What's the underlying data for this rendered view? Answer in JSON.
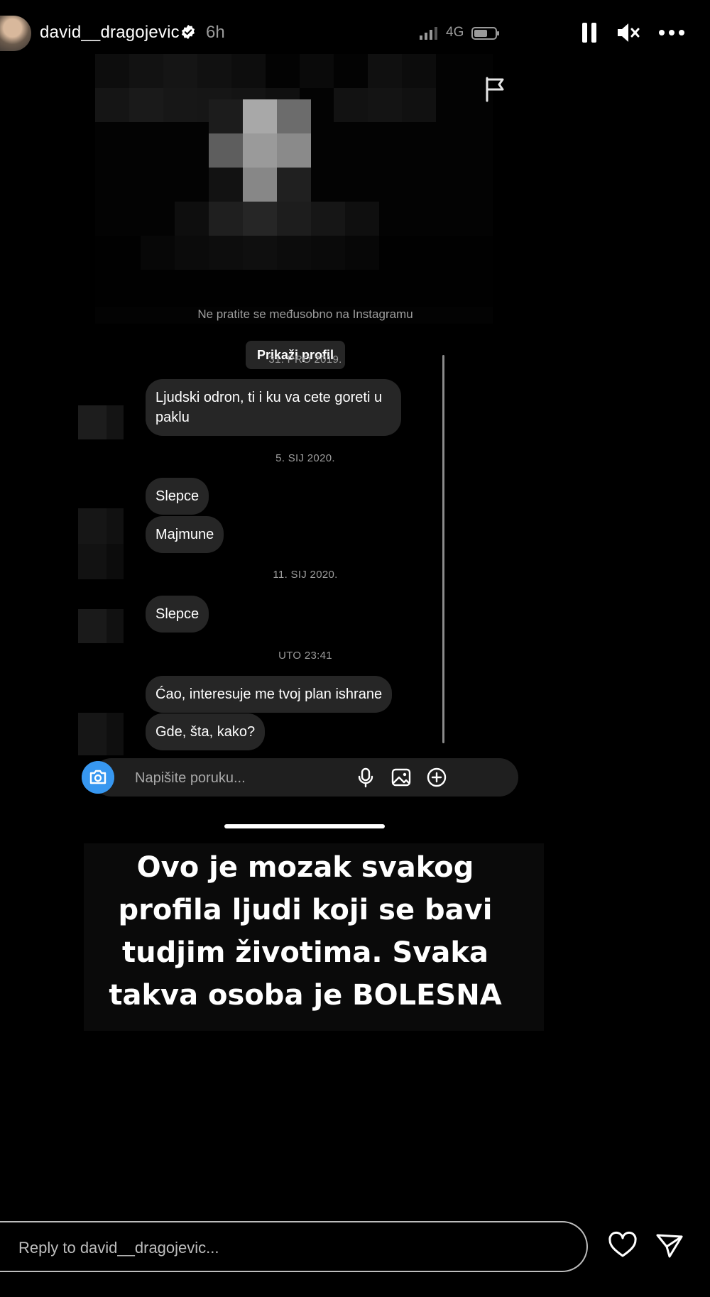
{
  "header": {
    "username": "david__dragojevic",
    "time_ago": "6h",
    "network": "4G"
  },
  "screenshot": {
    "not_following_notice": "Ne pratite se međusobno na Instagramu",
    "view_profile_label": "Prikaži profil",
    "dates": [
      "31. PRO 2019.",
      "5. SIJ 2020.",
      "11. SIJ 2020.",
      "UTO 23:41"
    ],
    "messages": [
      "Ljudski odron, ti i ku  va cete goreti u paklu",
      "Slepce",
      "Majmune",
      "Slepce",
      "Ćao, interesuje me tvoj plan ishrane",
      "Gde, šta, kako?"
    ],
    "composer_placeholder": "Napišite poruku..."
  },
  "caption": {
    "lines": [
      "Ovo je mozak svakog",
      "profila ljudi koji se bavi",
      "tudjim životima. Svaka",
      "takva osoba je BOLESNA"
    ]
  },
  "footer": {
    "reply_placeholder": "Reply to david__dragojevic..."
  },
  "icons": {
    "accent": "#3797f0",
    "bubble": "#262626"
  }
}
